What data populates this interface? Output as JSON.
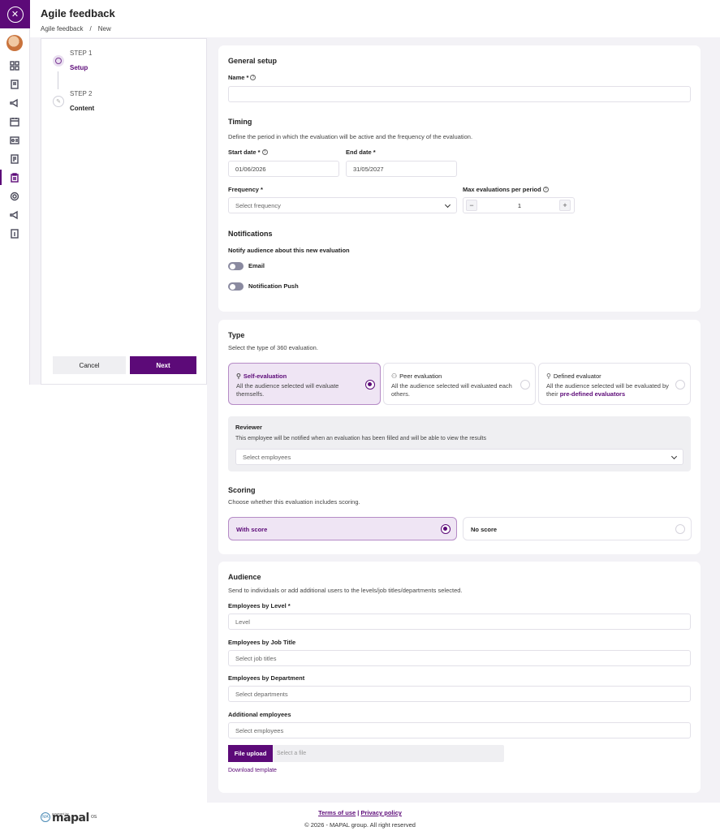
{
  "header": {
    "title": "Agile feedback",
    "breadcrumb": [
      "Agile feedback",
      "/",
      "New"
    ]
  },
  "sidebar": {
    "icons": [
      "dashboard-icon",
      "bookmark-icon",
      "megaphone-icon",
      "calendar-icon",
      "id-card-icon",
      "document-icon",
      "clipboard-icon",
      "settings-icon",
      "megaphone-icon",
      "info-icon"
    ],
    "active_index": 6,
    "brand_color": "#5c0a78"
  },
  "stepper": {
    "steps": [
      {
        "num": "STEP 1",
        "name": "Setup"
      },
      {
        "num": "STEP 2",
        "name": "Content"
      }
    ],
    "cancel_label": "Cancel",
    "next_label": "Next"
  },
  "general": {
    "title": "General setup",
    "name_label": "Name *",
    "name_value": ""
  },
  "timing": {
    "title": "Timing",
    "description": "Define the period in which the evaluation will be active and the frequency of the evaluation.",
    "start_label": "Start date *",
    "start_value": "01/06/2026",
    "end_label": "End date *",
    "end_value": "31/05/2027",
    "frequency_label": "Frequency *",
    "frequency_placeholder": "Select frequency",
    "max_label": "Max evaluations per period",
    "max_value": "1",
    "minus": "−",
    "plus": "+"
  },
  "notifications": {
    "title": "Notifications",
    "subtitle": "Notify audience about this new evaluation",
    "email_label": "Email",
    "email_on": false,
    "push_label": "Notification Push",
    "push_on": false
  },
  "type": {
    "title": "Type",
    "description": "Select the type of 360 evaluation.",
    "options": [
      {
        "title": "Self-evaluation",
        "desc": "All the audience selected will evaluate themselfs.",
        "selected": true
      },
      {
        "title": "Peer evaluation",
        "desc": "All the audience selected will evaluated each others.",
        "selected": false
      },
      {
        "title": "Defined evaluator",
        "desc_prefix": "All the audience selected will be evaluated by their",
        "desc_link": "pre-defined evaluators",
        "selected": false
      }
    ]
  },
  "reviewer": {
    "title": "Reviewer",
    "description": "This employee will be notified when an evaluation has been filled and will be able to view the results",
    "placeholder": "Select employees"
  },
  "scoring": {
    "title": "Scoring",
    "description": "Choose whether this evaluation includes scoring.",
    "with_score": "With score",
    "no_score": "No score",
    "selected": "With score"
  },
  "audience": {
    "title": "Audience",
    "description": "Send to individuals or add additional users to the levels/job titles/departments selected.",
    "level_label": "Employees by Level *",
    "level_placeholder": "Level",
    "job_label": "Employees by Job Title",
    "job_placeholder": "Select job titles",
    "dept_label": "Employees by Department",
    "dept_placeholder": "Select departments",
    "additional_label": "Additional employees",
    "additional_placeholder": "Select employees",
    "upload_label": "File upload",
    "upload_placeholder": "Select a file",
    "download_label": "Download template"
  },
  "footer": {
    "powered": "powered by",
    "brand": "mapal",
    "brand_suffix": "OS",
    "terms": "Terms of use",
    "divider": " | ",
    "privacy": "Privacy policy",
    "copyright": "© 2026 - MAPAL group. All right reserved"
  }
}
